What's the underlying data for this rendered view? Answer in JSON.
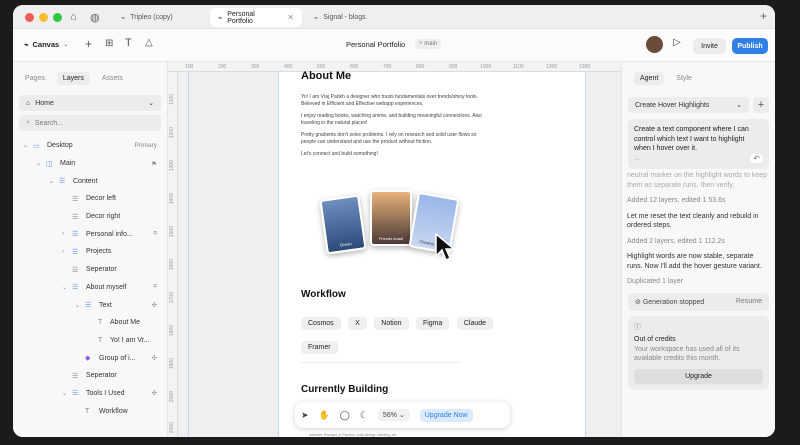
{
  "titlebar": {
    "tabs": [
      {
        "label": "Tripleo (copy)"
      },
      {
        "label": "Personal Portfolio"
      },
      {
        "label": "Signal - blogs"
      }
    ]
  },
  "toolbar": {
    "canvas_label": "Canvas",
    "project_title": "Personal Portfolio",
    "branch": "main",
    "invite_label": "Invite",
    "publish_label": "Publish"
  },
  "left_panel": {
    "tabs": [
      "Pages",
      "Layers",
      "Assets"
    ],
    "page_select": "Home",
    "search_placeholder": "Search...",
    "layers": [
      {
        "label": "Desktop",
        "right": "Primary"
      },
      {
        "label": "Main"
      },
      {
        "label": "Content"
      },
      {
        "label": "Decor left"
      },
      {
        "label": "Decor right"
      },
      {
        "label": "Personal info..."
      },
      {
        "label": "Projects"
      },
      {
        "label": "Seperator"
      },
      {
        "label": "About myself"
      },
      {
        "label": "Text"
      },
      {
        "label": "About Me"
      },
      {
        "label": "Yo! I am Vr..."
      },
      {
        "label": "Group of i..."
      },
      {
        "label": "Seperator"
      },
      {
        "label": "Tools I Used"
      },
      {
        "label": "Workflow"
      }
    ]
  },
  "canvas": {
    "ruler_top": [
      "100",
      "200",
      "300",
      "400",
      "500",
      "600",
      "700",
      "800",
      "900",
      "1000",
      "1100",
      "1200",
      "1300"
    ],
    "ruler_left": [
      "1100",
      "1200",
      "1300",
      "1400",
      "1500",
      "1600",
      "1700",
      "1800",
      "1900",
      "2000",
      "2100"
    ],
    "about_heading": "About Me",
    "about_paragraphs": [
      "Yo! I am Vraj Parikh a designer who trusts fundamentals over trends/shiny tools. Believed in Efficient and Effective webapp experiences.",
      "I enjoy reading books, watching anime, and building meaningful connections. Also traveling in the natural places!",
      "Pretty gradients don't solve problems. I rely on research and solid user flows so people can understand and use the product without friction.",
      "Let's connect and build something!"
    ],
    "photo_captions": [
      "Ocean",
      "Friends Avadi",
      "Chasing Sky"
    ],
    "workflow_heading": "Workflow",
    "workflow_tools": [
      "Cosmos",
      "X",
      "Notion",
      "Figma",
      "Claude",
      "Framer"
    ],
    "building_heading": "Currently Building",
    "bottom_text": "website Ravaux & Paxton. wall design landing all",
    "zoom": "56%",
    "upgrade_label": "Upgrade Now"
  },
  "right_panel": {
    "tabs": [
      "Agent",
      "Style"
    ],
    "dropdown": "Create Hover Highlights",
    "prompt": "Create a text component where I can control which text I want to highlight when I hover over it.",
    "prompt_ellipsis": "...",
    "messages": [
      "neutral marker on the highlight words to keep them as separate runs, then verify.",
      "Added 12 layers, edited 1 53.6s",
      "Let me reset the text cleanly and rebuild in ordered steps.",
      "Added 2 layers, edited 1 112.2s",
      "Highlight words are now stable, separate runs. Now I'll add the hover gesture variant.",
      "Duplicated 1 layer"
    ],
    "generation_status": "Generation stopped",
    "resume_label": "Resume",
    "credits_title": "Out of credits",
    "credits_text": "Your workspace has used all of its available credits this month.",
    "upgrade_label": "Upgrade"
  },
  "colors": {
    "accent": "#2f7fe8",
    "red": "#ec5f57",
    "yellow": "#f6be2f",
    "green": "#2fc840"
  }
}
